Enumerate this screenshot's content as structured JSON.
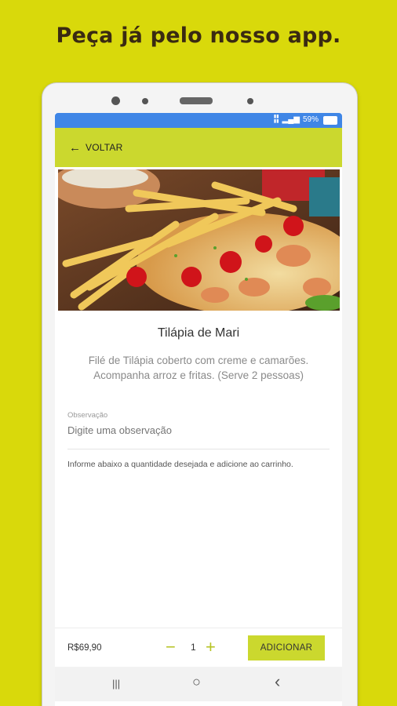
{
  "headline": "Peça já pelo nosso app.",
  "status": {
    "battery": "59%"
  },
  "appbar": {
    "back_label": "VOLTAR"
  },
  "icons": {
    "back": "arrow-left-icon",
    "minus": "minus-icon",
    "plus": "plus-icon",
    "recents": "recents-icon",
    "home": "home-icon",
    "nav_back": "chevron-left-icon"
  },
  "dish": {
    "name": "Tilápia de Mari",
    "description": "Filé de Tilápia coberto com creme e camarões. Acompanha arroz e fritas. (Serve 2 pessoas)"
  },
  "observation": {
    "label": "Observação",
    "placeholder": "Digite uma observação",
    "value": ""
  },
  "hint": "Informe abaixo a quantidade desejada e adicione ao carrinho.",
  "cart": {
    "price": "R$69,90",
    "quantity": "1",
    "minus_label": "−",
    "plus_label": "+",
    "add_label": "ADICIONAR"
  },
  "navbar": {
    "recents": "|||",
    "home": "○",
    "back": "‹"
  },
  "colors": {
    "background": "#d9d90b",
    "accent": "#cbd82e",
    "statusbar": "#3f86e6"
  }
}
